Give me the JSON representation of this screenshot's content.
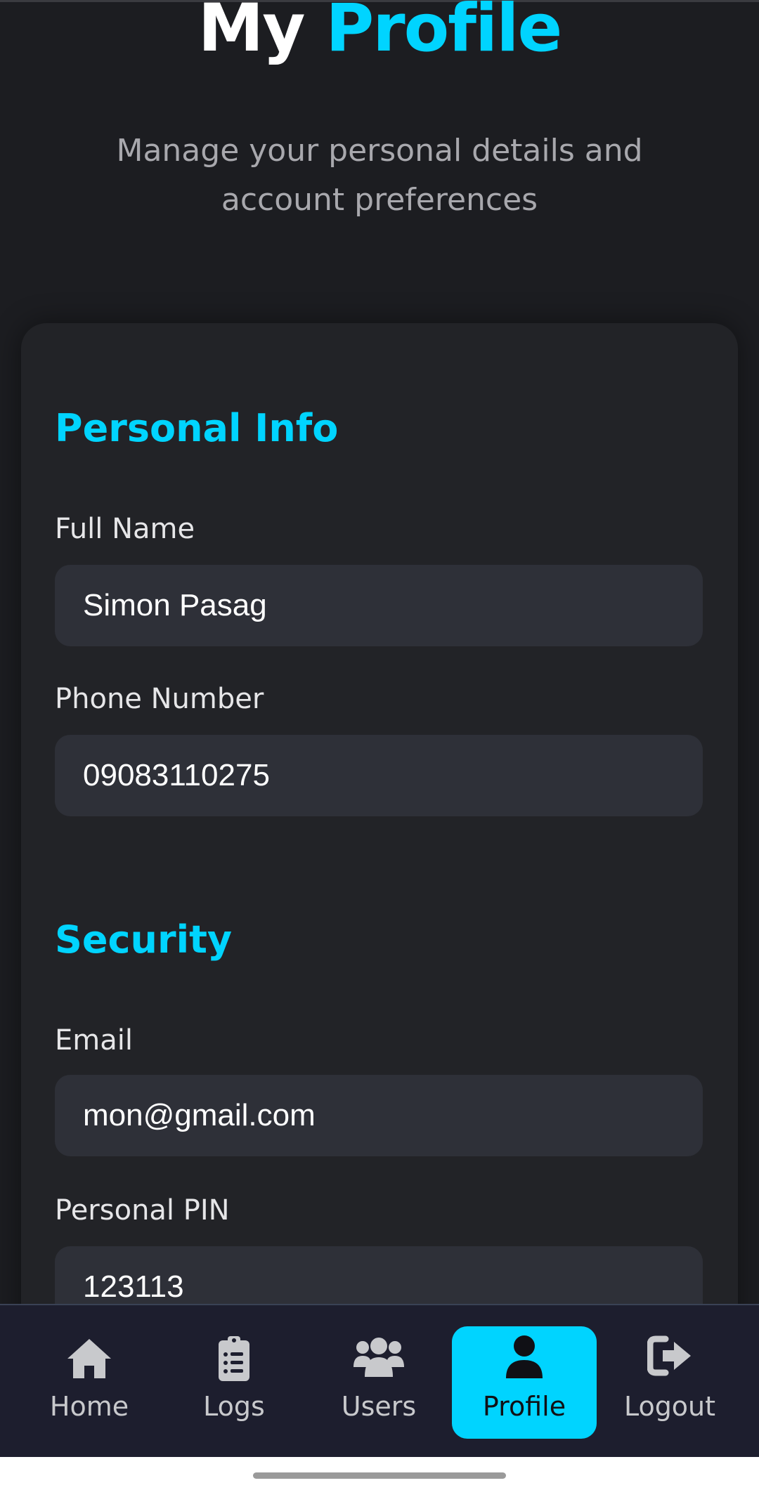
{
  "header": {
    "title_part1": "My",
    "title_part2": "Profile",
    "subtitle": "Manage your personal details and account preferences"
  },
  "personal_info": {
    "section_title": "Personal Info",
    "full_name_label": "Full Name",
    "full_name_value": "Simon Pasag",
    "phone_label": "Phone Number",
    "phone_value": "09083110275"
  },
  "security": {
    "section_title": "Security",
    "email_label": "Email",
    "email_value": "mon@gmail.com",
    "pin_label": "Personal PIN",
    "pin_value": "123113"
  },
  "bottom_nav": {
    "items": [
      {
        "label": "Home",
        "icon": "home-icon"
      },
      {
        "label": "Logs",
        "icon": "clipboard-list-icon"
      },
      {
        "label": "Users",
        "icon": "users-icon"
      },
      {
        "label": "Profile",
        "icon": "user-icon",
        "active": true
      },
      {
        "label": "Logout",
        "icon": "logout-icon"
      }
    ]
  },
  "colors": {
    "accent": "#00d4ff",
    "background": "#1c1d21",
    "card": "#222327",
    "input": "#2e3038",
    "nav": "#1d1e2e"
  }
}
